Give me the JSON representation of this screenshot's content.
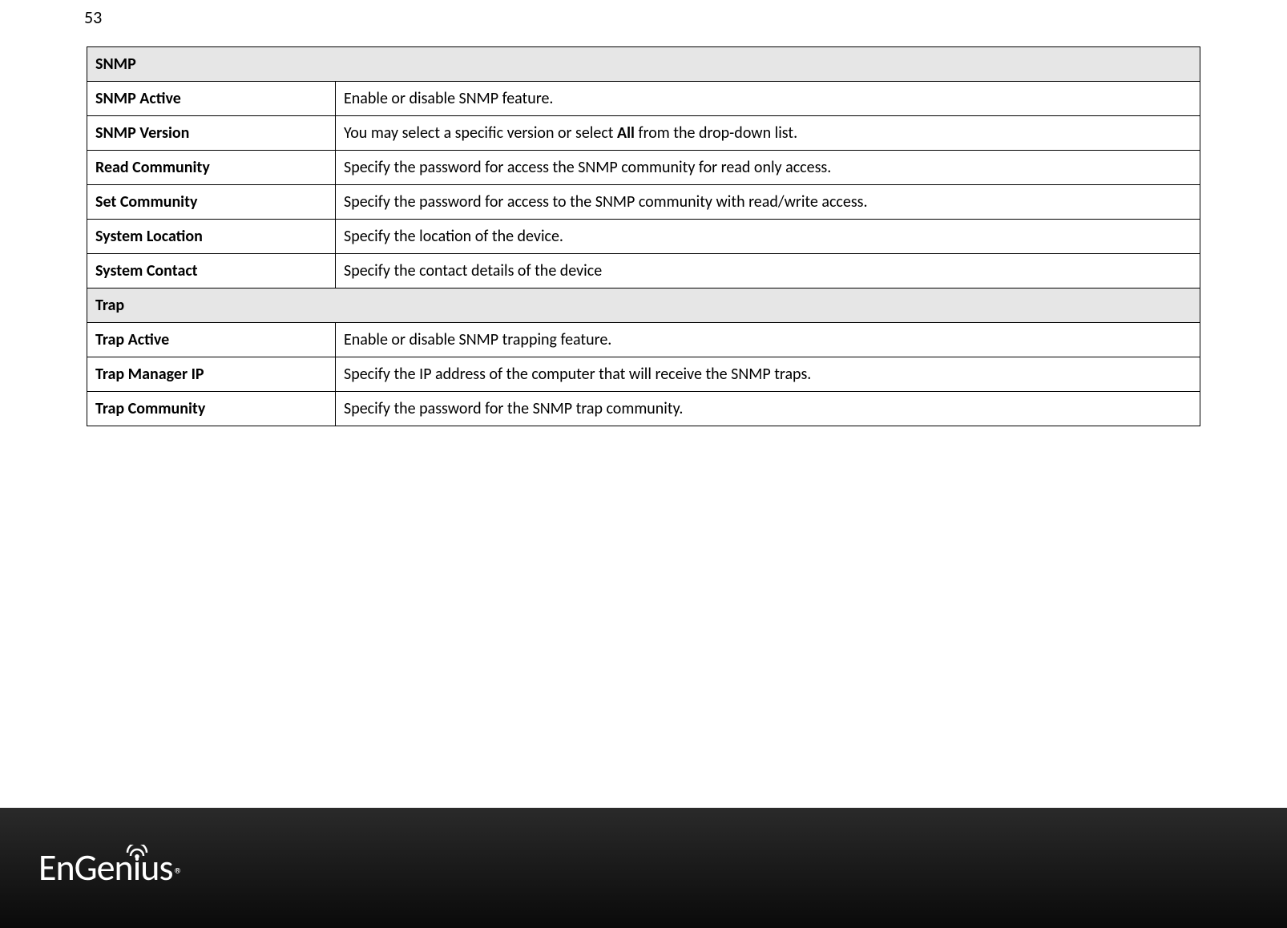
{
  "page_number": "53",
  "table": {
    "sections": [
      {
        "header": "SNMP",
        "rows": [
          {
            "label": "SNMP Active",
            "desc": "Enable or disable SNMP feature."
          },
          {
            "label": "SNMP Version",
            "desc_pre": "You may select a specific version or select ",
            "desc_bold": "All",
            "desc_post": " from the drop-down list."
          },
          {
            "label": "Read Community",
            "desc": "Specify the password for access the SNMP community for read only access."
          },
          {
            "label": "Set Community",
            "desc": "Specify the password for access to the SNMP community with read/write access."
          },
          {
            "label": "System Location",
            "desc": "Specify the location of the device."
          },
          {
            "label": "System Contact",
            "desc": "Specify the contact details of the device"
          }
        ]
      },
      {
        "header": "Trap",
        "rows": [
          {
            "label": "Trap Active",
            "desc": "Enable or disable SNMP trapping feature."
          },
          {
            "label": "Trap Manager IP",
            "desc": "Specify the IP address of the computer that will receive the SNMP traps."
          },
          {
            "label": "Trap Community",
            "desc": "Specify the password for the SNMP trap community."
          }
        ]
      }
    ]
  },
  "logo": {
    "text_pre": "EnGen",
    "text_i": "i",
    "text_post": "us",
    "reg": "®"
  }
}
